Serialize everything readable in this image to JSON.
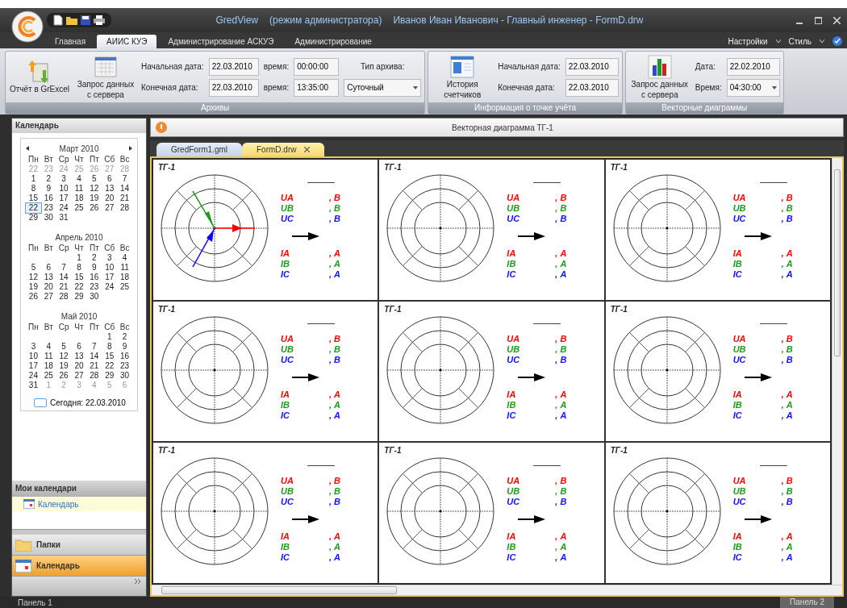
{
  "window": {
    "app": "GredView",
    "mode": "(режим администратора)",
    "user": "Иванов Иван Иванович - Главный инженер - FormD.drw"
  },
  "ribbon_tabs": [
    {
      "label": "Главная",
      "selected": false
    },
    {
      "label": "АИИС КУЭ",
      "selected": true
    },
    {
      "label": "Администрирование АСКУЭ",
      "selected": false
    },
    {
      "label": "Администрирование",
      "selected": false
    }
  ],
  "menu_right": [
    "Настройки",
    "Стиль"
  ],
  "ribbon_groups": [
    {
      "title": "Архивы",
      "buttons": [
        {
          "label": "Отчёт в GrExcel",
          "kind": "excel"
        },
        {
          "label": "Запрос данных с сервера",
          "kind": "calendar"
        }
      ],
      "fields": [
        {
          "label": "Начальная дата:",
          "value": "22.03.2010",
          "kind": "text"
        },
        {
          "label": "время:",
          "value": "00:00:00",
          "kind": "text"
        },
        {
          "label": "Тип архива:",
          "kind": "label"
        },
        {
          "label": "Конечная дата:",
          "value": "22.03.2010",
          "kind": "text"
        },
        {
          "label": "время:",
          "value": "13:35:00",
          "kind": "text"
        },
        {
          "value": "Суточный",
          "kind": "combo"
        }
      ]
    },
    {
      "title": "Информация о точке учёта",
      "buttons": [
        {
          "label": "История счетчиков",
          "kind": "history"
        }
      ],
      "fields": [
        {
          "label": "Начальная дата:",
          "value": "22.03.2010",
          "kind": "text"
        },
        {
          "label": "Конечная дата:",
          "value": "22.03.2010",
          "kind": "text"
        }
      ]
    },
    {
      "title": "Векторные диаграммы",
      "buttons": [
        {
          "label": "Запрос данных с сервера",
          "kind": "chart"
        }
      ],
      "fields": [
        {
          "label": "Дата:",
          "value": "22.02.2010",
          "kind": "text"
        },
        {
          "label": "Время:",
          "value": "04:30:00",
          "kind": "combo"
        }
      ]
    }
  ],
  "sidebar": {
    "header": "Календарь",
    "months": [
      {
        "title": "Март 2010",
        "weekdays": [
          "Пн",
          "Вт",
          "Ср",
          "Чт",
          "Пт",
          "Сб",
          "Вс"
        ],
        "weeks": [
          [
            {
              "d": "22",
              "muted": true,
              "today": false
            },
            {
              "d": "23",
              "muted": true,
              "today": false
            },
            {
              "d": "24",
              "muted": true,
              "today": false
            },
            {
              "d": "25",
              "muted": true,
              "today": false
            },
            {
              "d": "26",
              "muted": true,
              "today": false
            },
            {
              "d": "27",
              "muted": true,
              "today": false
            },
            {
              "d": "28",
              "muted": true,
              "today": false
            }
          ],
          [
            {
              "d": "1",
              "muted": false,
              "today": false
            },
            {
              "d": "2",
              "muted": false,
              "today": false
            },
            {
              "d": "3",
              "muted": false,
              "today": false
            },
            {
              "d": "4",
              "muted": false,
              "today": false
            },
            {
              "d": "5",
              "muted": false,
              "today": false
            },
            {
              "d": "6",
              "muted": false,
              "today": false
            },
            {
              "d": "7",
              "muted": false,
              "today": false
            }
          ],
          [
            {
              "d": "8",
              "muted": false,
              "today": false
            },
            {
              "d": "9",
              "muted": false,
              "today": false
            },
            {
              "d": "10",
              "muted": false,
              "today": false
            },
            {
              "d": "11",
              "muted": false,
              "today": false
            },
            {
              "d": "12",
              "muted": false,
              "today": false
            },
            {
              "d": "13",
              "muted": false,
              "today": false
            },
            {
              "d": "14",
              "muted": false,
              "today": false
            }
          ],
          [
            {
              "d": "15",
              "muted": false,
              "today": false
            },
            {
              "d": "16",
              "muted": false,
              "today": false
            },
            {
              "d": "17",
              "muted": false,
              "today": false
            },
            {
              "d": "18",
              "muted": false,
              "today": false
            },
            {
              "d": "19",
              "muted": false,
              "today": false
            },
            {
              "d": "20",
              "muted": false,
              "today": false
            },
            {
              "d": "21",
              "muted": false,
              "today": false
            }
          ],
          [
            {
              "d": "22",
              "muted": false,
              "today": true
            },
            {
              "d": "23",
              "muted": false,
              "today": false
            },
            {
              "d": "24",
              "muted": false,
              "today": false
            },
            {
              "d": "25",
              "muted": false,
              "today": false
            },
            {
              "d": "26",
              "muted": false,
              "today": false
            },
            {
              "d": "27",
              "muted": false,
              "today": false
            },
            {
              "d": "28",
              "muted": false,
              "today": false
            }
          ],
          [
            {
              "d": "29",
              "muted": false,
              "today": false
            },
            {
              "d": "30",
              "muted": false,
              "today": false
            },
            {
              "d": "31",
              "muted": false,
              "today": false
            }
          ]
        ]
      },
      {
        "title": "Апрель 2010",
        "weekdays": [
          "Пн",
          "Вт",
          "Ср",
          "Чт",
          "Пт",
          "Сб",
          "Вс"
        ],
        "weeks": [
          [
            {
              "d": "1",
              "muted": false,
              "today": false
            },
            {
              "d": "2",
              "muted": false,
              "today": false
            },
            {
              "d": "3",
              "muted": false,
              "today": false
            },
            {
              "d": "4",
              "muted": false,
              "today": false
            }
          ],
          [
            {
              "d": "5",
              "muted": false,
              "today": false
            },
            {
              "d": "6",
              "muted": false,
              "today": false
            },
            {
              "d": "7",
              "muted": false,
              "today": false
            },
            {
              "d": "8",
              "muted": false,
              "today": false
            },
            {
              "d": "9",
              "muted": false,
              "today": false
            },
            {
              "d": "10",
              "muted": false,
              "today": false
            },
            {
              "d": "11",
              "muted": false,
              "today": false
            }
          ],
          [
            {
              "d": "12",
              "muted": false,
              "today": false
            },
            {
              "d": "13",
              "muted": false,
              "today": false
            },
            {
              "d": "14",
              "muted": false,
              "today": false
            },
            {
              "d": "15",
              "muted": false,
              "today": false
            },
            {
              "d": "16",
              "muted": false,
              "today": false
            },
            {
              "d": "17",
              "muted": false,
              "today": false
            },
            {
              "d": "18",
              "muted": false,
              "today": false
            }
          ],
          [
            {
              "d": "19",
              "muted": false,
              "today": false
            },
            {
              "d": "20",
              "muted": false,
              "today": false
            },
            {
              "d": "21",
              "muted": false,
              "today": false
            },
            {
              "d": "22",
              "muted": false,
              "today": false
            },
            {
              "d": "23",
              "muted": false,
              "today": false
            },
            {
              "d": "24",
              "muted": false,
              "today": false
            },
            {
              "d": "25",
              "muted": false,
              "today": false
            }
          ],
          [
            {
              "d": "26",
              "muted": false,
              "today": false
            },
            {
              "d": "27",
              "muted": false,
              "today": false
            },
            {
              "d": "28",
              "muted": false,
              "today": false
            },
            {
              "d": "29",
              "muted": false,
              "today": false
            },
            {
              "d": "30",
              "muted": false,
              "today": false
            }
          ]
        ]
      },
      {
        "title": "Май 2010",
        "weekdays": [
          "Пн",
          "Вт",
          "Ср",
          "Чт",
          "Пт",
          "Сб",
          "Вс"
        ],
        "weeks": [
          [
            {
              "d": "1",
              "muted": false,
              "today": false
            },
            {
              "d": "2",
              "muted": false,
              "today": false
            }
          ],
          [
            {
              "d": "3",
              "muted": false,
              "today": false
            },
            {
              "d": "4",
              "muted": false,
              "today": false
            },
            {
              "d": "5",
              "muted": false,
              "today": false
            },
            {
              "d": "6",
              "muted": false,
              "today": false
            },
            {
              "d": "7",
              "muted": false,
              "today": false
            },
            {
              "d": "8",
              "muted": false,
              "today": false
            },
            {
              "d": "9",
              "muted": false,
              "today": false
            }
          ],
          [
            {
              "d": "10",
              "muted": false,
              "today": false
            },
            {
              "d": "11",
              "muted": false,
              "today": false
            },
            {
              "d": "12",
              "muted": false,
              "today": false
            },
            {
              "d": "13",
              "muted": false,
              "today": false
            },
            {
              "d": "14",
              "muted": false,
              "today": false
            },
            {
              "d": "15",
              "muted": false,
              "today": false
            },
            {
              "d": "16",
              "muted": false,
              "today": false
            }
          ],
          [
            {
              "d": "17",
              "muted": false,
              "today": false
            },
            {
              "d": "18",
              "muted": false,
              "today": false
            },
            {
              "d": "19",
              "muted": false,
              "today": false
            },
            {
              "d": "20",
              "muted": false,
              "today": false
            },
            {
              "d": "21",
              "muted": false,
              "today": false
            },
            {
              "d": "22",
              "muted": false,
              "today": false
            },
            {
              "d": "23",
              "muted": false,
              "today": false
            }
          ],
          [
            {
              "d": "24",
              "muted": false,
              "today": false
            },
            {
              "d": "25",
              "muted": false,
              "today": false
            },
            {
              "d": "26",
              "muted": false,
              "today": false
            },
            {
              "d": "27",
              "muted": false,
              "today": false
            },
            {
              "d": "28",
              "muted": false,
              "today": false
            },
            {
              "d": "29",
              "muted": false,
              "today": false
            },
            {
              "d": "30",
              "muted": false,
              "today": false
            }
          ],
          [
            {
              "d": "31",
              "muted": false,
              "today": false
            },
            {
              "d": "1",
              "muted": true,
              "today": false
            },
            {
              "d": "2",
              "muted": true,
              "today": false
            },
            {
              "d": "3",
              "muted": true,
              "today": false
            },
            {
              "d": "4",
              "muted": true,
              "today": false
            },
            {
              "d": "5",
              "muted": true,
              "today": false
            },
            {
              "d": "6",
              "muted": true,
              "today": false
            }
          ]
        ]
      }
    ],
    "today_label": "Сегодня: 22.03.2010",
    "my_calendars_header": "Мои календари",
    "my_calendars": [
      {
        "label": "Календарь",
        "selected": true
      }
    ],
    "nav_buttons": [
      {
        "label": "Папки",
        "kind": "folder",
        "selected": false
      },
      {
        "label": "Календарь",
        "kind": "calendar",
        "selected": true
      }
    ]
  },
  "pane": {
    "title": "Векторная диаграмма ТГ-1"
  },
  "doc_tabs": [
    {
      "label": "GredForm1.gml",
      "selected": false
    },
    {
      "label": "FormD.drw",
      "selected": true
    }
  ],
  "diagrams": [
    {
      "title": "ТГ-1",
      "vectors": true,
      "voltages": [
        {
          "label": "UA",
          "unit": ", В",
          "color": "#ff0000"
        },
        {
          "label": "UB",
          "unit": ", В",
          "color": "#1e9a1e"
        },
        {
          "label": "UC",
          "unit": ", В",
          "color": "#1010ff"
        }
      ],
      "currents": [
        {
          "label": "IA",
          "unit": ", А",
          "color": "#ff0000"
        },
        {
          "label": "IB",
          "unit": ", А",
          "color": "#1e9a1e"
        },
        {
          "label": "IC",
          "unit": ", А",
          "color": "#1010ff"
        }
      ]
    },
    {
      "title": "ТГ-1",
      "vectors": false,
      "voltages": [
        {
          "label": "UA",
          "unit": ", В",
          "color": "#ff0000"
        },
        {
          "label": "UB",
          "unit": ", В",
          "color": "#1e9a1e"
        },
        {
          "label": "UC",
          "unit": ", В",
          "color": "#1010ff"
        }
      ],
      "currents": [
        {
          "label": "IA",
          "unit": ", А",
          "color": "#ff0000"
        },
        {
          "label": "IB",
          "unit": ", А",
          "color": "#1e9a1e"
        },
        {
          "label": "IC",
          "unit": ", А",
          "color": "#1010ff"
        }
      ]
    },
    {
      "title": "ТГ-1",
      "vectors": false,
      "voltages": [
        {
          "label": "UA",
          "unit": ", В",
          "color": "#ff0000"
        },
        {
          "label": "UB",
          "unit": ", В",
          "color": "#1e9a1e"
        },
        {
          "label": "UC",
          "unit": ", В",
          "color": "#1010ff"
        }
      ],
      "currents": [
        {
          "label": "IA",
          "unit": ", А",
          "color": "#ff0000"
        },
        {
          "label": "IB",
          "unit": ", А",
          "color": "#1e9a1e"
        },
        {
          "label": "IC",
          "unit": ", А",
          "color": "#1010ff"
        }
      ]
    },
    {
      "title": "ТГ-1",
      "vectors": false,
      "voltages": [
        {
          "label": "UA",
          "unit": ", В",
          "color": "#ff0000"
        },
        {
          "label": "UB",
          "unit": ", В",
          "color": "#1e9a1e"
        },
        {
          "label": "UC",
          "unit": ", В",
          "color": "#1010ff"
        }
      ],
      "currents": [
        {
          "label": "IA",
          "unit": ", А",
          "color": "#ff0000"
        },
        {
          "label": "IB",
          "unit": ", А",
          "color": "#1e9a1e"
        },
        {
          "label": "IC",
          "unit": ", А",
          "color": "#1010ff"
        }
      ]
    },
    {
      "title": "ТГ-1",
      "vectors": false,
      "voltages": [
        {
          "label": "UA",
          "unit": ", В",
          "color": "#ff0000"
        },
        {
          "label": "UB",
          "unit": ", В",
          "color": "#1e9a1e"
        },
        {
          "label": "UC",
          "unit": ", В",
          "color": "#1010ff"
        }
      ],
      "currents": [
        {
          "label": "IA",
          "unit": ", А",
          "color": "#ff0000"
        },
        {
          "label": "IB",
          "unit": ", А",
          "color": "#1e9a1e"
        },
        {
          "label": "IC",
          "unit": ", А",
          "color": "#1010ff"
        }
      ]
    },
    {
      "title": "ТГ-1",
      "vectors": false,
      "voltages": [
        {
          "label": "UA",
          "unit": ", В",
          "color": "#ff0000"
        },
        {
          "label": "UB",
          "unit": ", В",
          "color": "#1e9a1e"
        },
        {
          "label": "UC",
          "unit": ", В",
          "color": "#1010ff"
        }
      ],
      "currents": [
        {
          "label": "IA",
          "unit": ", А",
          "color": "#ff0000"
        },
        {
          "label": "IB",
          "unit": ", А",
          "color": "#1e9a1e"
        },
        {
          "label": "IC",
          "unit": ", А",
          "color": "#1010ff"
        }
      ]
    },
    {
      "title": "ТГ-1",
      "vectors": false,
      "voltages": [
        {
          "label": "UA",
          "unit": ", В",
          "color": "#ff0000"
        },
        {
          "label": "UB",
          "unit": ", В",
          "color": "#1e9a1e"
        },
        {
          "label": "UC",
          "unit": ", В",
          "color": "#1010ff"
        }
      ],
      "currents": [
        {
          "label": "IA",
          "unit": ", А",
          "color": "#ff0000"
        },
        {
          "label": "IB",
          "unit": ", А",
          "color": "#1e9a1e"
        },
        {
          "label": "IC",
          "unit": ", А",
          "color": "#1010ff"
        }
      ]
    },
    {
      "title": "ТГ-1",
      "vectors": false,
      "voltages": [
        {
          "label": "UA",
          "unit": ", В",
          "color": "#ff0000"
        },
        {
          "label": "UB",
          "unit": ", В",
          "color": "#1e9a1e"
        },
        {
          "label": "UC",
          "unit": ", В",
          "color": "#1010ff"
        }
      ],
      "currents": [
        {
          "label": "IA",
          "unit": ", А",
          "color": "#ff0000"
        },
        {
          "label": "IB",
          "unit": ", А",
          "color": "#1e9a1e"
        },
        {
          "label": "IC",
          "unit": ", А",
          "color": "#1010ff"
        }
      ]
    },
    {
      "title": "ТГ-1",
      "vectors": false,
      "voltages": [
        {
          "label": "UA",
          "unit": ", В",
          "color": "#ff0000"
        },
        {
          "label": "UB",
          "unit": ", В",
          "color": "#1e9a1e"
        },
        {
          "label": "UC",
          "unit": ", В",
          "color": "#1010ff"
        }
      ],
      "currents": [
        {
          "label": "IA",
          "unit": ", А",
          "color": "#ff0000"
        },
        {
          "label": "IB",
          "unit": ", А",
          "color": "#1e9a1e"
        },
        {
          "label": "IC",
          "unit": ", А",
          "color": "#1010ff"
        }
      ]
    }
  ],
  "status_bar": {
    "left": "Панель 1",
    "right": "Панель 2"
  }
}
